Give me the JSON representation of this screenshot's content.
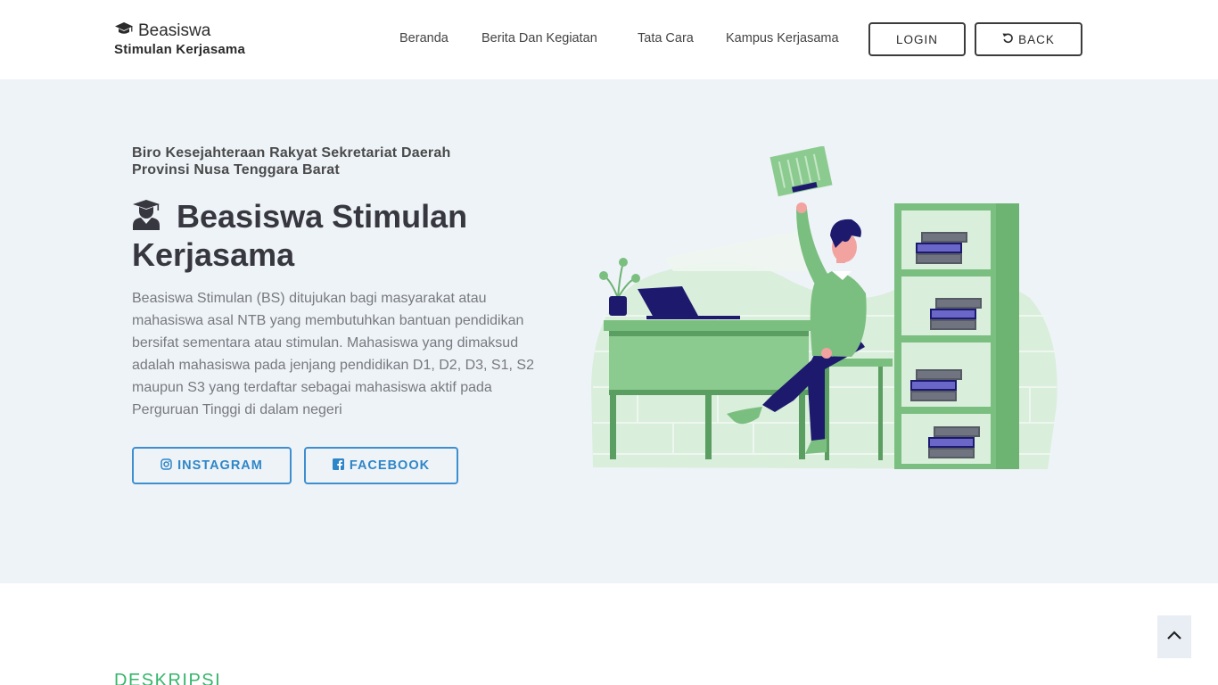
{
  "header": {
    "brand_title": "Beasiswa",
    "brand_subtitle": "Stimulan Kerjasama",
    "nav": [
      {
        "label": "Beranda"
      },
      {
        "label": "Berita Dan Kegiatan"
      },
      {
        "label": "Tata Cara"
      },
      {
        "label": "Kampus Kerjasama"
      }
    ],
    "login_label": "LOGIN",
    "back_label": "BACK"
  },
  "hero": {
    "org_line1": "Biro Kesejahteraan Rakyat Sekretariat Daerah",
    "org_line2": "Provinsi Nusa Tenggara Barat",
    "title": "Beasiswa Stimulan Kerjasama",
    "description": "Beasiswa Stimulan (BS) ditujukan bagi masyarakat atau mahasiswa asal NTB yang membutuhkan bantuan pendidikan bersifat sementara atau stimulan. Mahasiswa yang dimaksud adalah mahasiswa pada jenjang pendidikan D1, D2, D3, S1, S2 maupun S3 yang terdaftar sebagai mahasiswa aktif pada Perguruan Tinggi di dalam negeri",
    "instagram_label": "INSTAGRAM",
    "facebook_label": "FACEBOOK"
  },
  "section": {
    "label": "DESKRIPSI"
  },
  "icons": {
    "brand": "graduation-cap-icon",
    "back": "undo-icon",
    "title": "user-graduate-icon",
    "instagram": "instagram-icon",
    "facebook": "facebook-icon",
    "to_top": "chevron-up-icon"
  },
  "colors": {
    "hero_bg": "#eef3f7",
    "accent_green": "#35b56b",
    "social_blue": "#2e86c8",
    "illustration_green": "#7bbf80",
    "illustration_navy": "#1d1a6e"
  }
}
